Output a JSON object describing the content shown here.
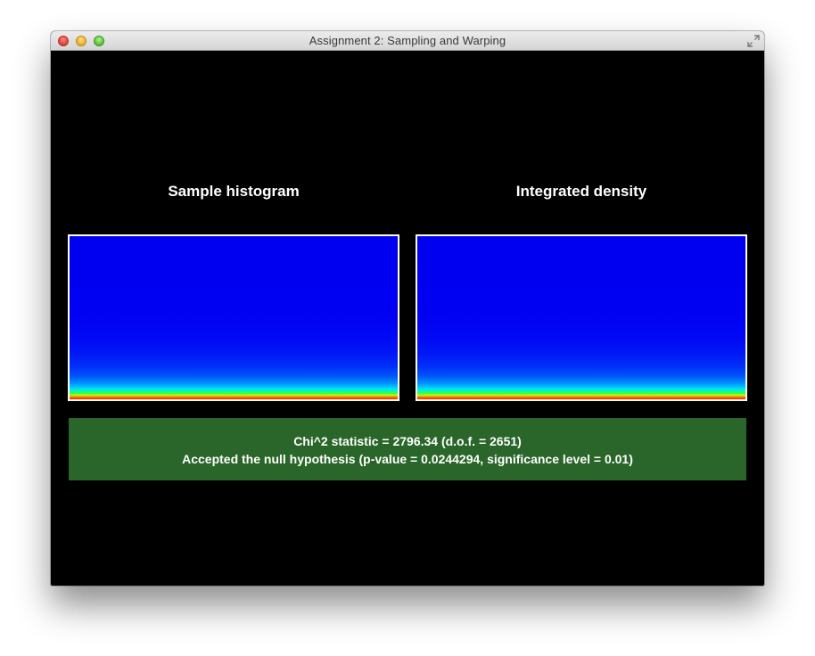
{
  "window": {
    "title": "Assignment 2: Sampling and Warping"
  },
  "panels": {
    "left_title": "Sample histogram",
    "right_title": "Integrated density"
  },
  "result": {
    "statistic_line": "Chi^2 statistic = 2796.34 (d.o.f. = 2651)",
    "conclusion_line": "Accepted the null hypothesis (p-value = 0.0244294, significance level = 0.01)",
    "status": "accepted",
    "background_color": "#2a6629"
  },
  "icons": {
    "close": "close-icon",
    "minimize": "minimize-icon",
    "zoom": "zoom-icon",
    "fullscreen": "fullscreen-icon"
  },
  "colors": {
    "heatmap_low": "#0000f0",
    "heatmap_high": "#ff2000",
    "panel_border": "#ffffff",
    "content_background": "#000000"
  }
}
